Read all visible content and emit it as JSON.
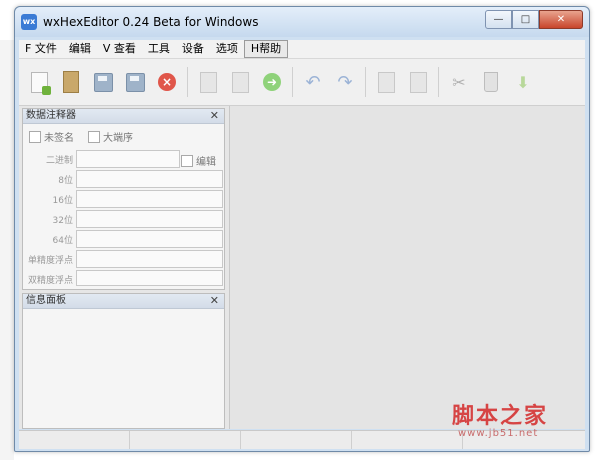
{
  "window": {
    "title": "wxHexEditor 0.24 Beta for Windows",
    "icon_text": "wx"
  },
  "window_controls": {
    "minimize": "—",
    "maximize": "□",
    "close": "✕"
  },
  "menu": [
    "F 文件",
    "编辑",
    "V 查看",
    "工具",
    "设备",
    "选项",
    "H帮助"
  ],
  "data_panel": {
    "title": "数据注释器",
    "close": "✕",
    "unsigned_label": "未签名",
    "big_endian_label": "大端序",
    "edit_label": "编辑",
    "fields": [
      "二进制",
      "8位",
      "16位",
      "32位",
      "64位",
      "单精度浮点",
      "双精度浮点"
    ]
  },
  "info_panel": {
    "title": "信息面板",
    "close": "✕"
  },
  "watermark": {
    "text": "脚本之家",
    "url": "www.jb51.net"
  }
}
